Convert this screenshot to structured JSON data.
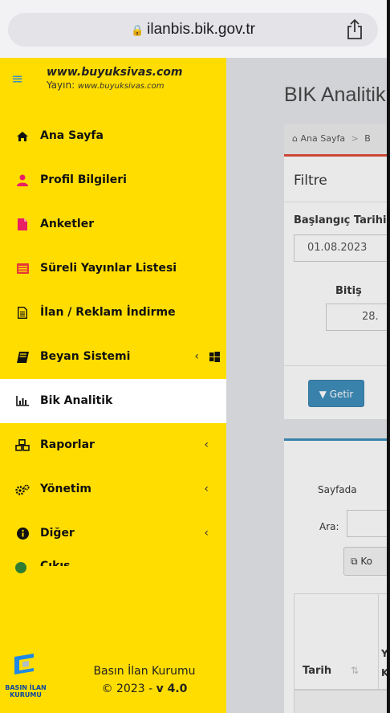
{
  "browser": {
    "url": "ilanbis.bik.gov.tr"
  },
  "sidebar": {
    "site_name": "www.buyuksivas.com",
    "site_sub_prefix": "Yayın:",
    "site_sub_url": "www.buyuksivas.com",
    "items": [
      {
        "label": "Ana Sayfa",
        "icon": "home-icon",
        "color": "#111111"
      },
      {
        "label": "Profil Bilgileri",
        "icon": "user-icon",
        "color": "#e91e63"
      },
      {
        "label": "Anketler",
        "icon": "file-icon",
        "color": "#e91e63"
      },
      {
        "label": "Süreli Yayınlar Listesi",
        "icon": "list-alt-icon",
        "color": "#e53935"
      },
      {
        "label": "İlan / Reklam İndirme",
        "icon": "file-text-icon",
        "color": "#111111"
      },
      {
        "label": "Beyan Sistemi",
        "icon": "book-icon",
        "color": "#111111",
        "chevron": "‹"
      },
      {
        "label": "Bik Analitik",
        "icon": "bar-chart-icon",
        "color": "#111111",
        "active": true
      },
      {
        "label": "Raporlar",
        "icon": "cubes-icon",
        "color": "#111111",
        "chevron": "‹"
      },
      {
        "label": "Yönetim",
        "icon": "cogs-icon",
        "color": "#111111",
        "chevron": "‹"
      },
      {
        "label": "Diğer",
        "icon": "info-icon",
        "color": "#111111",
        "chevron": "‹"
      },
      {
        "label": "Çıkış",
        "icon": "exit-icon",
        "color": "#2e7d32"
      }
    ],
    "footer": {
      "line1": "Basın İlan Kurumu",
      "line2_prefix": "© 2023 - ",
      "version": "v 4.0",
      "logo_text": "BASIN İLAN KURUMU"
    }
  },
  "main": {
    "page_title": "BIK Analitik",
    "breadcrumb_home": "Ana Sayfa",
    "breadcrumb_sep": ">",
    "breadcrumb_next": "B",
    "filter_title": "Filtre",
    "start_label": "Başlangıç Tarihi",
    "start_value": "01.08.2023",
    "end_label": "Bitiş",
    "end_value": "28.",
    "getir_label": "Getir",
    "sayfada_label": "Sayfada",
    "ara_label": "Ara:",
    "kopyala_label": "Ko",
    "th_tarih": "Tarih",
    "th_y": "Y",
    "th_k": "K"
  }
}
